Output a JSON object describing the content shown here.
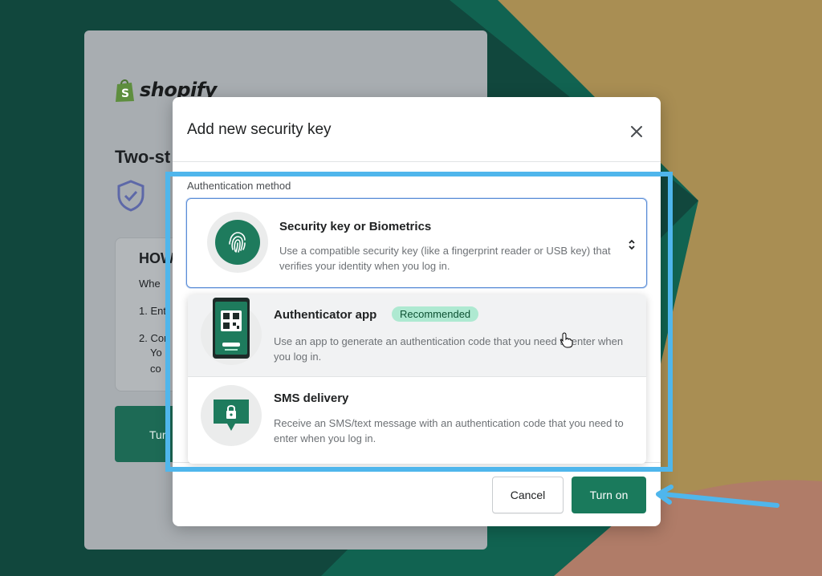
{
  "background": {
    "brand": "shopify",
    "heading": "Two-st",
    "box_title": "HOW",
    "box_lines": [
      "Whe",
      "1. Ent",
      "2. Con",
      "Yo",
      "co"
    ],
    "button_partial": "Tur"
  },
  "modal": {
    "title": "Add new security key",
    "field_label": "Authentication method",
    "selected": {
      "title": "Security key or Biometrics",
      "description": "Use a compatible security key (like a fingerprint reader or USB key) that verifies your identity when you log in.",
      "icon": "fingerprint-icon"
    },
    "options": [
      {
        "title": "Authenticator app",
        "badge": "Recommended",
        "description": "Use an app to generate an authentication code that you need to enter when you log in.",
        "icon": "phone-qr-icon"
      },
      {
        "title": "SMS delivery",
        "description": "Receive an SMS/text message with an authentication code that you need to enter when you log in.",
        "icon": "sms-lock-icon"
      }
    ],
    "cancel_label": "Cancel",
    "turn_on_label": "Turn on"
  },
  "colors": {
    "accent": "#1a7a5c",
    "badge_bg": "#aee9d1",
    "highlight": "#4fb6ec"
  }
}
